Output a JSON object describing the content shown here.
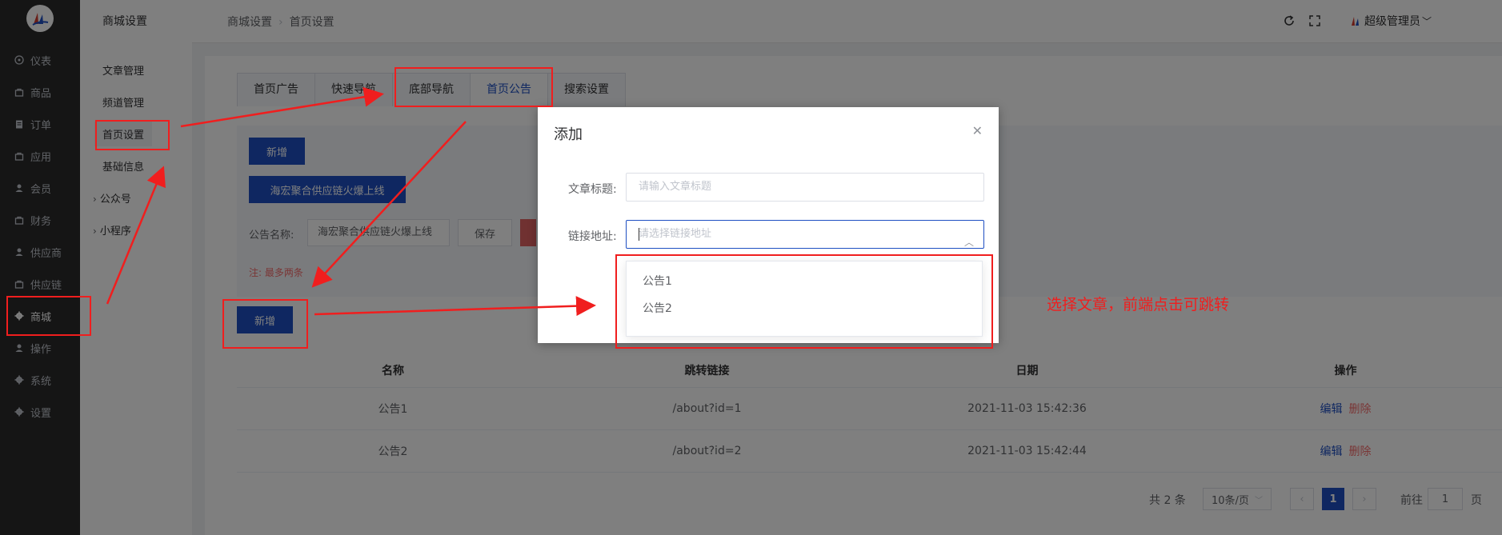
{
  "nav": {
    "items": [
      {
        "label": "仪表",
        "icon": "gauge-icon"
      },
      {
        "label": "商品",
        "icon": "bag-icon"
      },
      {
        "label": "订单",
        "icon": "clipboard-icon"
      },
      {
        "label": "应用",
        "icon": "bag-icon"
      },
      {
        "label": "会员",
        "icon": "user-icon"
      },
      {
        "label": "财务",
        "icon": "bag-icon"
      },
      {
        "label": "供应商",
        "icon": "user-icon"
      },
      {
        "label": "供应链",
        "icon": "bag-icon"
      },
      {
        "label": "商城",
        "icon": "gear-icon"
      },
      {
        "label": "操作",
        "icon": "user-icon"
      },
      {
        "label": "系统",
        "icon": "gear-icon"
      },
      {
        "label": "设置",
        "icon": "gear-icon"
      }
    ]
  },
  "subnav": {
    "title": "商城设置",
    "items": [
      "文章管理",
      "频道管理",
      "首页设置",
      "基础信息"
    ],
    "groups": [
      "公众号",
      "小程序"
    ]
  },
  "header": {
    "breadcrumb": [
      "商城设置",
      "首页设置"
    ],
    "user": "超级管理员"
  },
  "tabs": [
    "首页广告",
    "快速导航",
    "底部导航",
    "首页公告",
    "搜索设置"
  ],
  "panel": {
    "add_label": "新增",
    "notice_button": "海宏聚合供应链火爆上线",
    "name_label": "公告名称:",
    "name_value": "海宏聚合供应链火爆上线",
    "save_label": "保存",
    "note": "注: 最多两条"
  },
  "add_button": "新增",
  "table": {
    "headers": [
      "名称",
      "跳转链接",
      "日期",
      "操作"
    ],
    "rows": [
      {
        "name": "公告1",
        "link": "/about?id=1",
        "date": "2021-11-03 15:42:36"
      },
      {
        "name": "公告2",
        "link": "/about?id=2",
        "date": "2021-11-03 15:42:44"
      }
    ],
    "edit_label": "编辑",
    "delete_label": "删除"
  },
  "pagination": {
    "total": "共 2 条",
    "page_size": "10条/页",
    "current": "1",
    "goto_label": "前往",
    "goto_value": "1",
    "page_suffix": "页"
  },
  "modal": {
    "title": "添加",
    "title_label": "文章标题:",
    "title_placeholder": "请输入文章标题",
    "link_label": "链接地址:",
    "link_placeholder": "请选择链接地址",
    "options": [
      "公告1",
      "公告2"
    ]
  },
  "annotation": "选择文章，前端点击可跳转",
  "colors": {
    "primary": "#1e4fc2",
    "danger": "#f56c6c",
    "annotation": "#f01e1e",
    "sidebar": "#2b2b2b"
  }
}
